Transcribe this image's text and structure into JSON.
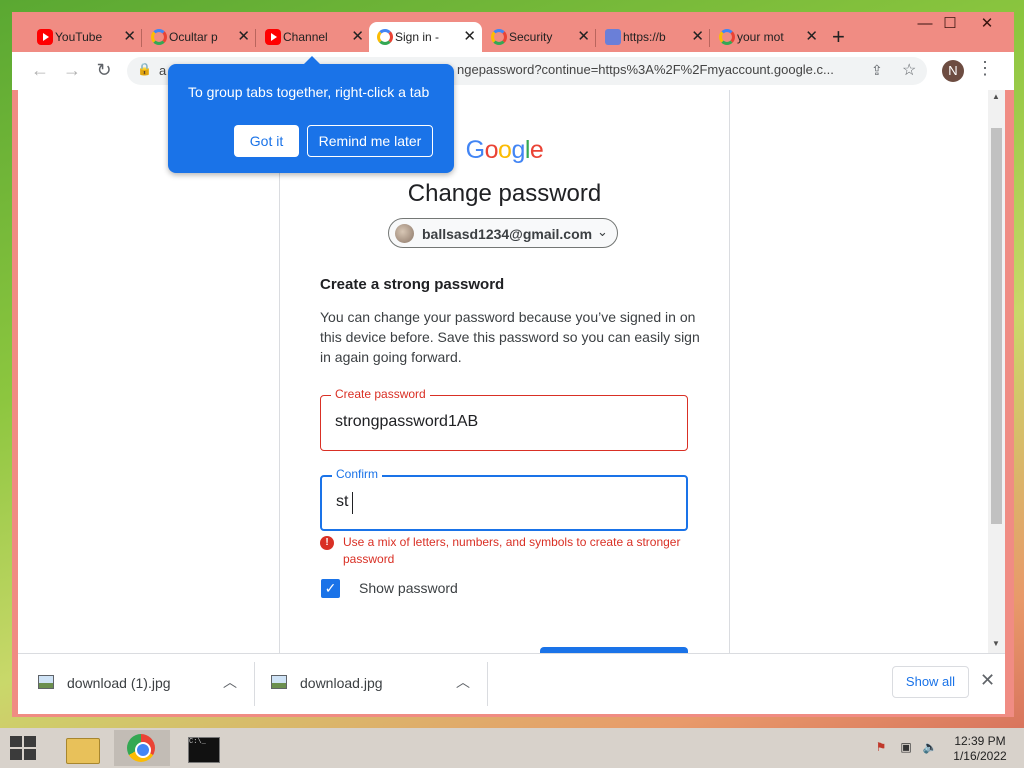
{
  "window": {
    "minimize": "—",
    "maximize": "☐",
    "close": "✕"
  },
  "tabs": [
    {
      "label": "YouTube",
      "icon": "youtube-icon"
    },
    {
      "label": "Ocultar p",
      "icon": "google-icon"
    },
    {
      "label": "Channel",
      "icon": "youtube-icon"
    },
    {
      "label": "Sign in -",
      "icon": "google-icon",
      "active": true
    },
    {
      "label": "Security",
      "icon": "google-icon"
    },
    {
      "label": "https://b",
      "icon": "page-icon"
    },
    {
      "label": "your mot",
      "icon": "google-icon"
    }
  ],
  "toolbar": {
    "url_prefix": "a",
    "url": "ngepassword?continue=https%3A%2F%2Fmyaccount.google.c...",
    "profile_initial": "N"
  },
  "tooltip": {
    "text": "To group tabs together, right-click a tab",
    "got_it": "Got it",
    "remind": "Remind me later"
  },
  "page": {
    "logo": "Google",
    "title": "Change password",
    "account": "ballsasd1234@gmail.com",
    "subtitle": "Create a strong password",
    "description": "You can change your password because you’ve signed in on this device before. Save this password so you can easily sign in again going forward.",
    "create_label": "Create password",
    "create_value": "strongpassword1AB",
    "confirm_label": "Confirm",
    "confirm_value": "st",
    "error": "Use a mix of letters, numbers, and symbols to create a stronger password",
    "show_password": "Show password"
  },
  "downloads": {
    "items": [
      {
        "name": "download (1).jpg"
      },
      {
        "name": "download.jpg"
      }
    ],
    "show_all": "Show all"
  },
  "taskbar": {
    "time": "12:39 PM",
    "date": "1/16/2022"
  },
  "colors": {
    "frame": "#f08c83",
    "accent": "#1a73e8",
    "error": "#d93025"
  }
}
